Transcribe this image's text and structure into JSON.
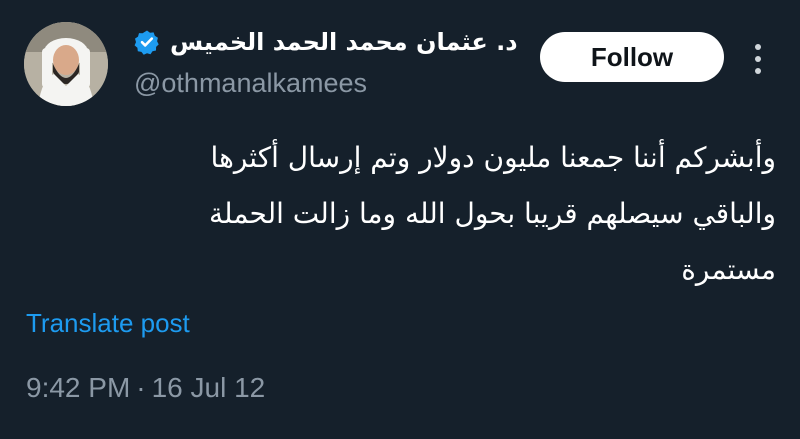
{
  "author": {
    "display_name": "د. عثمان محمد الحمد الخميس",
    "handle": "@othmanalkamees",
    "verified_icon": "verified-badge-icon",
    "avatar_icon": "profile-photo"
  },
  "actions": {
    "follow_label": "Follow",
    "more_icon": "more-vertical-icon"
  },
  "tweet": {
    "text": "وأبشركم أننا جمعنا مليون دولار وتم إرسال أكثرها\nوالباقي سيصلهم قريبا بحول الله وما زالت الحملة\nمستمرة",
    "translate_label": "Translate post",
    "time": "9:42 PM",
    "separator": "·",
    "date": "16 Jul 12"
  },
  "colors": {
    "background": "#15202b",
    "link": "#1d9bf0",
    "muted": "#8b98a5",
    "verified": "#1d9bf0"
  }
}
